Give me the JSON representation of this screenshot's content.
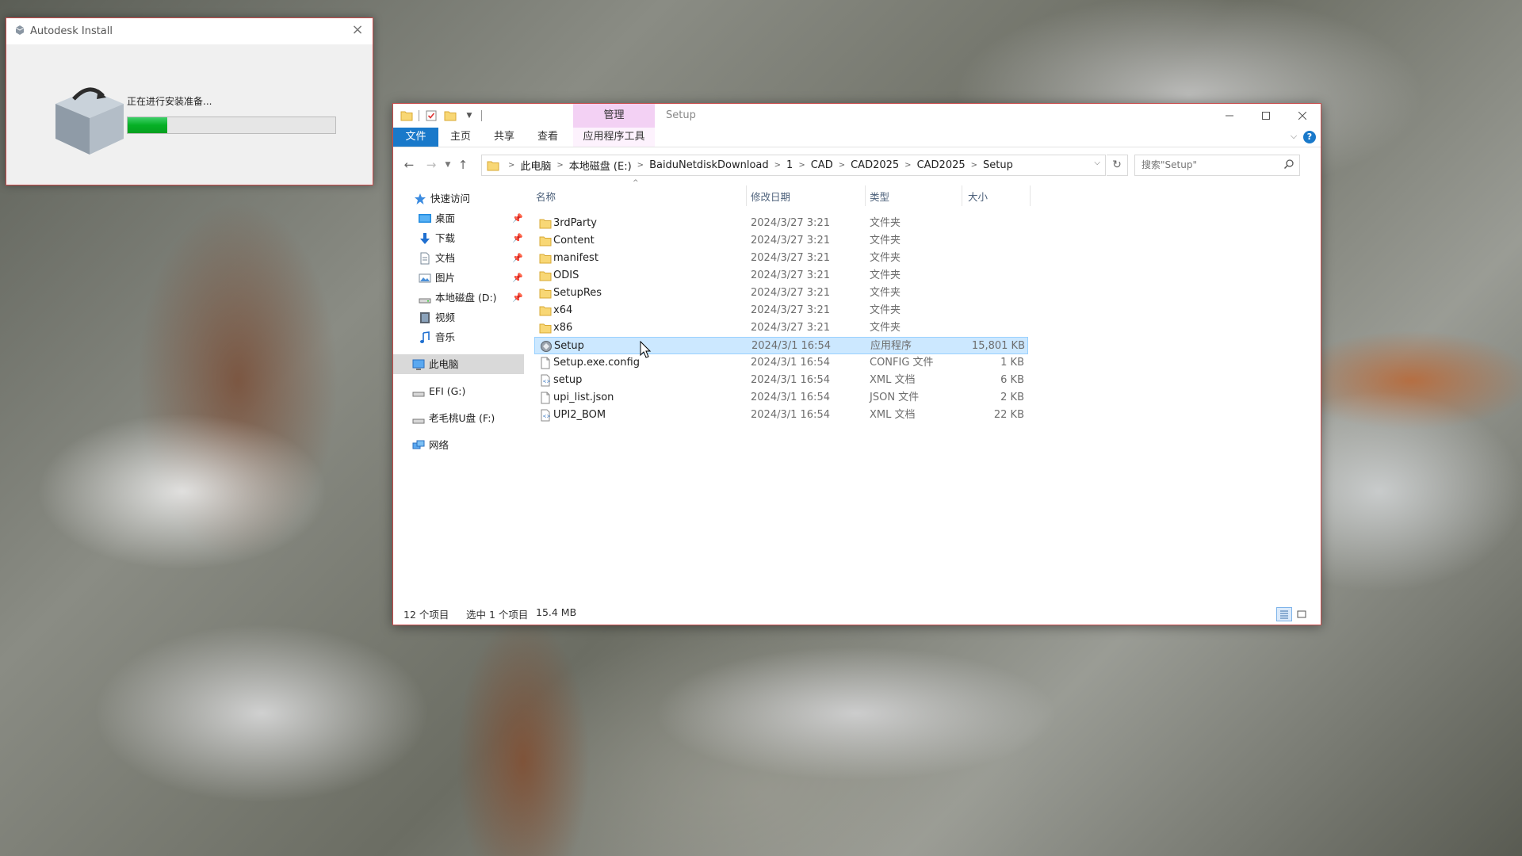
{
  "autodesk": {
    "title": "Autodesk Install",
    "status": "正在进行安装准备...",
    "progress_fraction": 0.19
  },
  "explorer": {
    "window_title": "Setup",
    "context_tab_header": "管理",
    "ribbon_tabs": {
      "file": "文件",
      "home": "主页",
      "share": "共享",
      "view": "查看",
      "app_tools": "应用程序工具"
    },
    "breadcrumb": [
      "此电脑",
      "本地磁盘 (E:)",
      "BaiduNetdiskDownload",
      "1",
      "CAD",
      "CAD2025",
      "CAD2025",
      "Setup"
    ],
    "search_placeholder": "搜索\"Setup\"",
    "nav": {
      "quick_access": "快速访问",
      "desktop": "桌面",
      "downloads": "下载",
      "documents": "文档",
      "pictures": "图片",
      "local_disk_d": "本地磁盘 (D:)",
      "videos": "视频",
      "music": "音乐",
      "this_pc": "此电脑",
      "efi": "EFI (G:)",
      "usb": "老毛桃U盘 (F:)",
      "network": "网络"
    },
    "columns": {
      "name": "名称",
      "date": "修改日期",
      "type": "类型",
      "size": "大小"
    },
    "files": [
      {
        "name": "3rdParty",
        "date": "2024/3/27 3:21",
        "type": "文件夹",
        "size": "",
        "icon": "folder-icon"
      },
      {
        "name": "Content",
        "date": "2024/3/27 3:21",
        "type": "文件夹",
        "size": "",
        "icon": "folder-icon"
      },
      {
        "name": "manifest",
        "date": "2024/3/27 3:21",
        "type": "文件夹",
        "size": "",
        "icon": "folder-icon"
      },
      {
        "name": "ODIS",
        "date": "2024/3/27 3:21",
        "type": "文件夹",
        "size": "",
        "icon": "folder-icon"
      },
      {
        "name": "SetupRes",
        "date": "2024/3/27 3:21",
        "type": "文件夹",
        "size": "",
        "icon": "folder-icon"
      },
      {
        "name": "x64",
        "date": "2024/3/27 3:21",
        "type": "文件夹",
        "size": "",
        "icon": "folder-icon"
      },
      {
        "name": "x86",
        "date": "2024/3/27 3:21",
        "type": "文件夹",
        "size": "",
        "icon": "folder-icon"
      },
      {
        "name": "Setup",
        "date": "2024/3/1 16:54",
        "type": "应用程序",
        "size": "15,801 KB",
        "icon": "app-icon",
        "selected": true
      },
      {
        "name": "Setup.exe.config",
        "date": "2024/3/1 16:54",
        "type": "CONFIG 文件",
        "size": "1 KB",
        "icon": "file-icon"
      },
      {
        "name": "setup",
        "date": "2024/3/1 16:54",
        "type": "XML 文档",
        "size": "6 KB",
        "icon": "xml-file-icon"
      },
      {
        "name": "upi_list.json",
        "date": "2024/3/1 16:54",
        "type": "JSON 文件",
        "size": "2 KB",
        "icon": "file-icon"
      },
      {
        "name": "UPI2_BOM",
        "date": "2024/3/1 16:54",
        "type": "XML 文档",
        "size": "22 KB",
        "icon": "xml-file-icon"
      }
    ],
    "status": {
      "count": "12 个项目",
      "selection": "选中 1 个项目",
      "selection_size": "15.4 MB"
    },
    "colors": {
      "file_tab": "#1979ca",
      "context_tab": "#f3d1f4",
      "selection": "#cce8ff",
      "folder": "#f8d775"
    }
  }
}
